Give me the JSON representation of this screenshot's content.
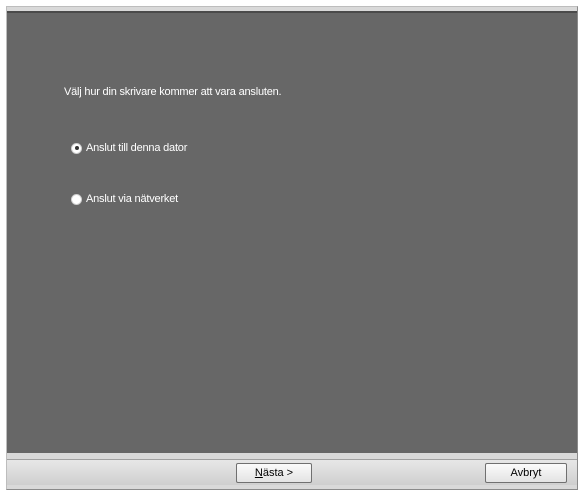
{
  "wizard": {
    "prompt": "Välj hur din skrivare kommer att vara ansluten.",
    "options": [
      {
        "label": "Anslut till denna dator",
        "selected": true
      },
      {
        "label": "Anslut via nätverket",
        "selected": false
      }
    ]
  },
  "buttons": {
    "next_accel": "N",
    "next_rest": "ästa >",
    "cancel": "Avbryt"
  },
  "colors": {
    "panel_background": "#676767",
    "text": "#ffffff"
  }
}
